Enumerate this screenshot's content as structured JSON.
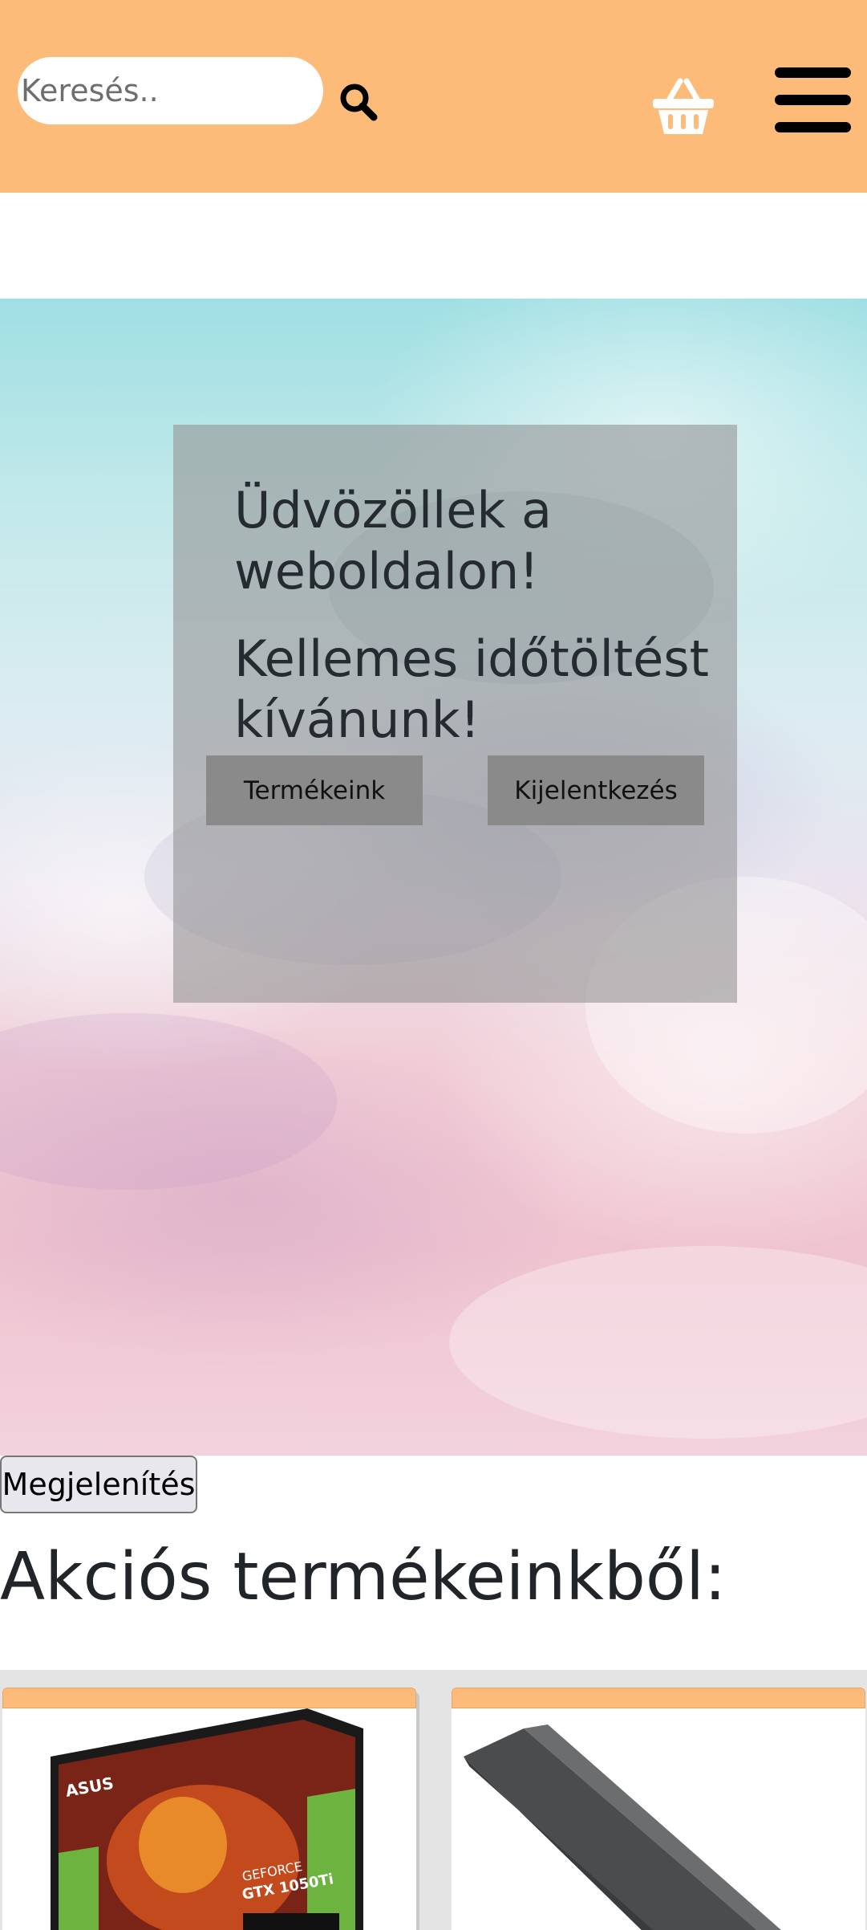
{
  "header": {
    "search": {
      "placeholder": "Keresés..",
      "value": ""
    },
    "icons": {
      "search": "search-icon",
      "cart": "basket-icon",
      "menu": "hamburger-menu-icon"
    },
    "background_color": "#fdbb7a"
  },
  "hero": {
    "title": "Üdvözöllek a weboldalon!",
    "subtitle": "Kellemes időtöltést kívánunk!",
    "buttons": {
      "products": "Termékeink",
      "logout": "Kijelentkezés"
    }
  },
  "display_button": "Megjelenítés",
  "sale_section": {
    "heading": "Akciós termékeinkből:",
    "products": [
      {
        "image": "asus-geforce-gtx-1050-ti-box",
        "box_text": [
          "ASUS",
          "GEFORCE",
          "GTX 1050Ti"
        ]
      },
      {
        "image": "dark-gray-laptop-battery"
      }
    ]
  }
}
